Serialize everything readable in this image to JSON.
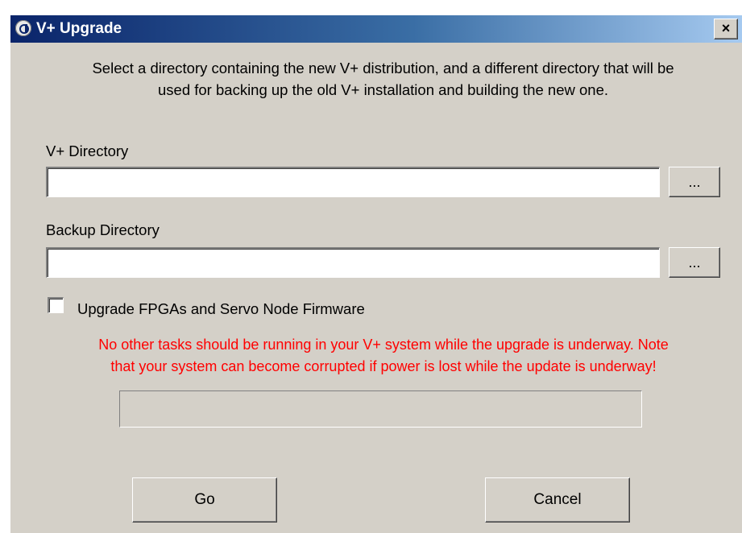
{
  "window": {
    "title": "V+ Upgrade",
    "app_icon": "adept-logo-icon",
    "close_label": "×",
    "title_gradient": [
      "#0a246a",
      "#a6caf0"
    ]
  },
  "instructions": {
    "line1": "Select a directory containing the new V+ distribution, and a different directory that will be",
    "line2": "used for backing up the old V+ installation and building the new one."
  },
  "vplus_directory": {
    "label": "V+ Directory",
    "value": "",
    "browse_label": "..."
  },
  "backup_directory": {
    "label": "Backup Directory",
    "value": "",
    "browse_label": "..."
  },
  "upgrade_option": {
    "label": "Upgrade FPGAs and Servo Node Firmware",
    "checked": false
  },
  "warning": {
    "line1": "No other tasks should be running in your V+ system while the upgrade is underway. Note",
    "line2": "that your system can become corrupted if power is lost while the update is underway!",
    "color": "#ff0000"
  },
  "progress": {
    "fraction": 0
  },
  "buttons": {
    "go_label": "Go",
    "cancel_label": "Cancel"
  }
}
